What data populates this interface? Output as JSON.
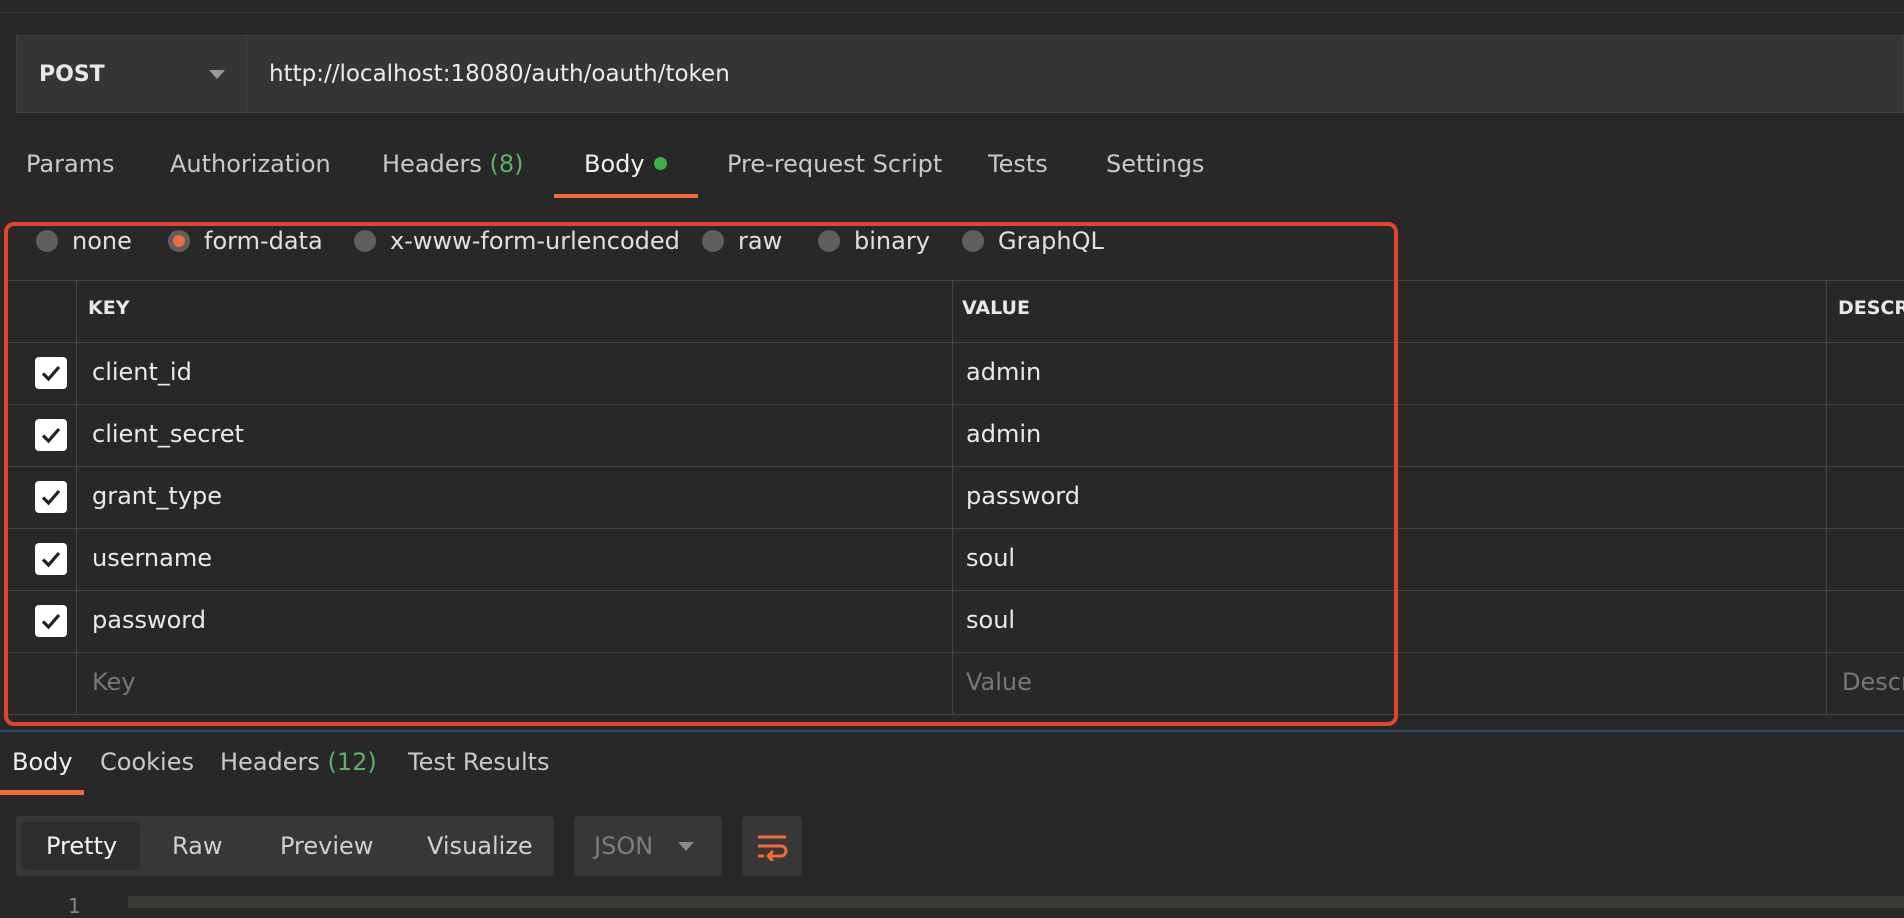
{
  "request": {
    "method": "POST",
    "url": "http://localhost:18080/auth/oauth/token"
  },
  "request_tabs": [
    {
      "label": "Params"
    },
    {
      "label": "Authorization"
    },
    {
      "label": "Headers",
      "count": "(8)"
    },
    {
      "label": "Body",
      "active": true
    },
    {
      "label": "Pre-request Script"
    },
    {
      "label": "Tests"
    },
    {
      "label": "Settings"
    }
  ],
  "body_types": [
    {
      "label": "none"
    },
    {
      "label": "form-data",
      "selected": true
    },
    {
      "label": "x-www-form-urlencoded"
    },
    {
      "label": "raw"
    },
    {
      "label": "binary"
    },
    {
      "label": "GraphQL"
    }
  ],
  "table": {
    "headers": {
      "key": "KEY",
      "value": "VALUE",
      "description": "DESCRI"
    },
    "rows": [
      {
        "checked": true,
        "key": "client_id",
        "value": "admin"
      },
      {
        "checked": true,
        "key": "client_secret",
        "value": "admin"
      },
      {
        "checked": true,
        "key": "grant_type",
        "value": "password"
      },
      {
        "checked": true,
        "key": "username",
        "value": "soul"
      },
      {
        "checked": true,
        "key": "password",
        "value": "soul"
      }
    ],
    "placeholder": {
      "key": "Key",
      "value": "Value",
      "description": "Descri"
    }
  },
  "response": {
    "tabs": [
      {
        "label": "Body",
        "active": true
      },
      {
        "label": "Cookies"
      },
      {
        "label": "Headers",
        "count": "(12)"
      },
      {
        "label": "Test Results"
      }
    ],
    "view_modes": [
      "Pretty",
      "Raw",
      "Preview",
      "Visualize"
    ],
    "format": "JSON",
    "editor_first_line_number": "1"
  },
  "colors": {
    "accent": "#f26b3a",
    "count_green": "#5fb065",
    "dot_green": "#3cb14a",
    "highlight_box": "#e2452f"
  },
  "icons": {
    "method_dropdown": "chevron-down-icon",
    "checkbox": "check-icon",
    "wrap_lines": "wrap-lines-icon",
    "format_dropdown": "chevron-down-icon"
  }
}
